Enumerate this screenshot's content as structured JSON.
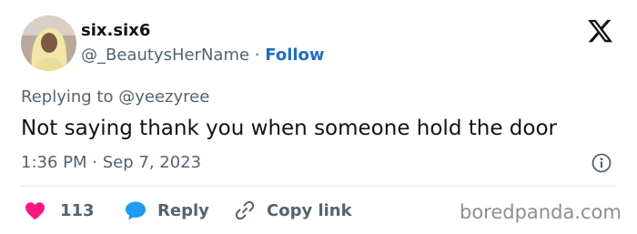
{
  "user": {
    "display_name": "six.six6",
    "handle": "@_BeautysHerName",
    "separator": "·",
    "follow_label": "Follow"
  },
  "tweet": {
    "replying_prefix": "Replying to",
    "replying_to": "@yeezyree",
    "text": "Not saying thank you when someone hold the door",
    "time": "1:36 PM",
    "date_separator": "·",
    "date": "Sep 7, 2023"
  },
  "actions": {
    "like_count": "113",
    "reply_label": "Reply",
    "copy_label": "Copy link"
  },
  "watermark": "boredpanda.com",
  "icons": {
    "logo": "x-logo-icon",
    "info": "info-icon",
    "like": "heart-icon",
    "reply": "speech-bubble-icon",
    "copy": "link-icon"
  },
  "colors": {
    "text_primary": "#0f1419",
    "text_secondary": "#536471",
    "follow": "#1d6fc0",
    "heart": "#f91880",
    "reply_bubble": "#1d9bf0"
  }
}
